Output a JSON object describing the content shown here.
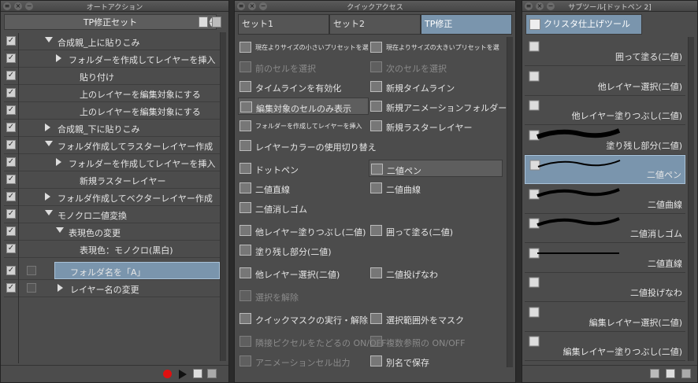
{
  "auto_action": {
    "title": "オートアクション",
    "set_name": "TP修正セット",
    "rows": [
      {
        "label": "合成親_上に貼りこみ",
        "depth": 1,
        "expand": "down",
        "sel": false
      },
      {
        "label": "フォルダーを作成してレイヤーを挿入",
        "depth": 2,
        "expand": "right",
        "sel": false
      },
      {
        "label": "貼り付け",
        "depth": 3,
        "expand": "none",
        "sel": false
      },
      {
        "label": "上のレイヤーを編集対象にする",
        "depth": 3,
        "expand": "none",
        "sel": false
      },
      {
        "label": "上のレイヤーを編集対象にする",
        "depth": 3,
        "expand": "none",
        "sel": false
      },
      {
        "label": "合成親_下に貼りこみ",
        "depth": 1,
        "expand": "right",
        "sel": false
      },
      {
        "label": "フォルダ作成してラスターレイヤー作成",
        "depth": 1,
        "expand": "down",
        "sel": false
      },
      {
        "label": "フォルダーを作成してレイヤーを挿入",
        "depth": 2,
        "expand": "right",
        "sel": false
      },
      {
        "label": "新規ラスターレイヤー",
        "depth": 3,
        "expand": "none",
        "sel": false
      },
      {
        "label": "フォルダ作成してベクターレイヤー作成",
        "depth": 1,
        "expand": "right",
        "sel": false
      },
      {
        "label": "モノクロ二値変換",
        "depth": 1,
        "expand": "down",
        "sel": false
      },
      {
        "label": "表現色の変更",
        "depth": 2,
        "expand": "down",
        "sel": false
      },
      {
        "label": "表現色：モノクロ(黒白)",
        "depth": 3,
        "expand": "none",
        "sel": false
      },
      {
        "label": "フォルダ名を「A」",
        "depth": 0,
        "expand": "none",
        "sel": true
      },
      {
        "label": "レイヤー名の変更",
        "depth": 0,
        "expand": "right",
        "sel": false
      }
    ]
  },
  "quick_access": {
    "title": "クイックアクセス",
    "tabs": [
      "セット1",
      "セット2",
      "TP修正"
    ],
    "items": [
      {
        "label": "現在よりサイズの小さいプリセットを選",
        "icon": "size-down-icon",
        "dis": false,
        "small": true
      },
      {
        "label": "現在よりサイズの大きいプリセットを選",
        "icon": "size-up-icon",
        "dis": false,
        "small": true
      },
      {
        "label": "前のセルを選択",
        "icon": "prev-cell-icon",
        "dis": true,
        "small": false
      },
      {
        "label": "次のセルを選択",
        "icon": "next-cell-icon",
        "dis": true,
        "small": false
      },
      {
        "label": "タイムラインを有効化",
        "icon": "timeline-icon",
        "dis": false,
        "small": false
      },
      {
        "label": "新規タイムライン",
        "icon": "new-timeline-icon",
        "dis": false,
        "small": false
      },
      {
        "label": "編集対象のセルのみ表示",
        "icon": "cell-only-icon",
        "dis": false,
        "small": false
      },
      {
        "label": "新規アニメーションフォルダー",
        "icon": "anim-folder-icon",
        "dis": false,
        "small": false
      },
      {
        "label": "フォルダーを作成してレイヤーを挿入",
        "icon": "folder-icon",
        "dis": false,
        "small": true
      },
      {
        "label": "新規ラスターレイヤー",
        "icon": "raster-layer-icon",
        "dis": false,
        "small": false
      },
      {
        "label": "レイヤーカラーの使用切り替え",
        "icon": "layer-color-icon",
        "dis": false,
        "small": false
      },
      {
        "label": "ドットペン",
        "icon": "dot-pen-icon",
        "dis": false,
        "small": false
      },
      {
        "label": "二値ペン",
        "icon": "binary-pen-icon",
        "dis": false,
        "small": false
      },
      {
        "label": "二値直線",
        "icon": "line-icon",
        "dis": false,
        "small": false
      },
      {
        "label": "二値曲線",
        "icon": "curve-icon",
        "dis": false,
        "small": false
      },
      {
        "label": "二値消しゴム",
        "icon": "eraser-icon",
        "dis": false,
        "small": false
      },
      {
        "label": "他レイヤー塗りつぶし(二値)",
        "icon": "fill-icon",
        "dis": false,
        "small": false
      },
      {
        "label": "囲って塗る(二値)",
        "icon": "enclose-fill-icon",
        "dis": false,
        "small": false
      },
      {
        "label": "塗り残し部分(二値)",
        "icon": "fill-gap-icon",
        "dis": false,
        "small": false
      },
      {
        "label": "他レイヤー選択(二値)",
        "icon": "wand-icon",
        "dis": false,
        "small": false
      },
      {
        "label": "二値投げなわ",
        "icon": "lasso-icon",
        "dis": false,
        "small": false
      },
      {
        "label": "選択を解除",
        "icon": "deselect-icon",
        "dis": true,
        "small": false
      },
      {
        "label": "クイックマスクの実行・解除",
        "icon": "quickmask-icon",
        "dis": false,
        "small": false
      },
      {
        "label": "選択範囲外をマスク",
        "icon": "mask-outside-icon",
        "dis": false,
        "small": false
      },
      {
        "label": "隣接ピクセルをたどるの ON/OFF",
        "icon": "adjacent-icon",
        "dis": true,
        "small": false
      },
      {
        "label": "複数参照の ON/OFF",
        "icon": "multi-ref-icon",
        "dis": true,
        "small": false
      },
      {
        "label": "アニメーションセル出力",
        "icon": "anim-export-icon",
        "dis": true,
        "small": false
      },
      {
        "label": "別名で保存",
        "icon": "save-as-icon",
        "dis": false,
        "small": false
      }
    ]
  },
  "sub_tool": {
    "title": "サブツール[ドットペン 2]",
    "group": "クリスタ仕上げツール",
    "items": [
      {
        "label": "囲って塗る(二値)",
        "icon": "enclose-fill-icon",
        "sel": false
      },
      {
        "label": "他レイヤー選択(二値)",
        "icon": "wand-icon",
        "sel": false
      },
      {
        "label": "他レイヤー塗りつぶし(二値)",
        "icon": "fill-icon",
        "sel": false
      },
      {
        "label": "塗り残し部分(二値)",
        "icon": "fill-gap-icon",
        "sel": false
      },
      {
        "label": "二値ペン",
        "icon": "binary-pen-icon",
        "sel": true
      },
      {
        "label": "二値曲線",
        "icon": "curve-icon",
        "sel": false
      },
      {
        "label": "二値消しゴム",
        "icon": "eraser-icon",
        "sel": false
      },
      {
        "label": "二値直線",
        "icon": "line-icon",
        "sel": false
      },
      {
        "label": "二値投げなわ",
        "icon": "lasso-icon",
        "sel": false
      },
      {
        "label": "編集レイヤー選択(二値)",
        "icon": "wand-icon",
        "sel": false
      },
      {
        "label": "編集レイヤー塗りつぶし(二値)",
        "icon": "fill-icon",
        "sel": false
      }
    ]
  },
  "colors": {
    "accent": "#7a95ad",
    "panel": "#4c4c4c",
    "record": "#e01010"
  }
}
